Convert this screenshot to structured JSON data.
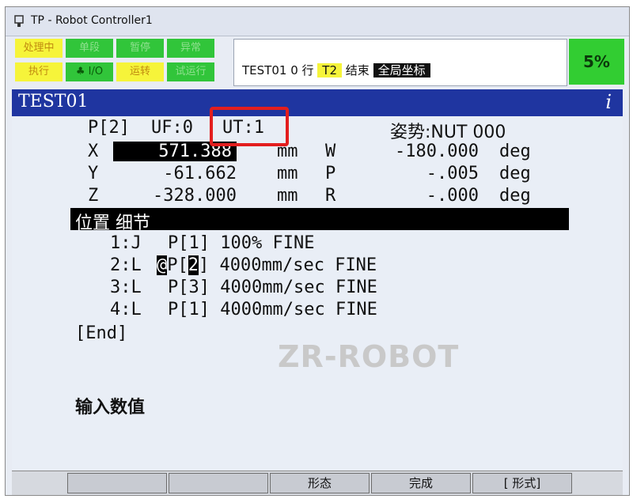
{
  "window": {
    "title": "TP - Robot Controller1"
  },
  "status": {
    "buttons_top": [
      "处理中",
      "单段",
      "暂停",
      "异常"
    ],
    "buttons_bottom": [
      "执行",
      "I/O",
      "运转",
      "试运行"
    ],
    "program": "TEST01",
    "line_no": "0 行",
    "mode": "T2",
    "state": "结束",
    "coord": "全局坐标",
    "override": "5%"
  },
  "screen": {
    "title": "TEST01",
    "info": "i"
  },
  "position": {
    "label": "P[2]",
    "uf": "UF:0",
    "ut": "UT:1",
    "config": "姿势:NUT 000",
    "rows": [
      {
        "axis": "X",
        "value": "571.388",
        "unit": "mm",
        "raxis": "W",
        "rvalue": "-180.000",
        "runit": "deg"
      },
      {
        "axis": "Y",
        "value": "-61.662",
        "unit": "mm",
        "raxis": "P",
        "rvalue": "-.005",
        "runit": "deg"
      },
      {
        "axis": "Z",
        "value": "-328.000",
        "unit": "mm",
        "raxis": "R",
        "rvalue": "-.000",
        "runit": "deg"
      }
    ]
  },
  "detail_bar": "位置 细节",
  "program_lines": [
    {
      "no": "1:J",
      "at": "",
      "pt": "P[",
      "idx": "1",
      "end": "]",
      "rest": "100% FINE"
    },
    {
      "no": "2:L",
      "at": "@",
      "pt": "P[",
      "idx": "2",
      "end": "]",
      "rest": "4000mm/sec FINE"
    },
    {
      "no": "3:L",
      "at": "",
      "pt": "P[",
      "idx": "3",
      "end": "]",
      "rest": "4000mm/sec FINE"
    },
    {
      "no": "4:L",
      "at": "",
      "pt": "P[",
      "idx": "1",
      "end": "]",
      "rest": "4000mm/sec FINE"
    }
  ],
  "end_marker": "[End]",
  "prompt": "输入数值",
  "watermark": "ZR-ROBOT",
  "function_keys": [
    "",
    "",
    "形态",
    "完成",
    "[ 形式]",
    ""
  ],
  "colors": {
    "header": "#1f35a0",
    "override_bg": "#32cd32",
    "highlight": "#e31e1e"
  }
}
